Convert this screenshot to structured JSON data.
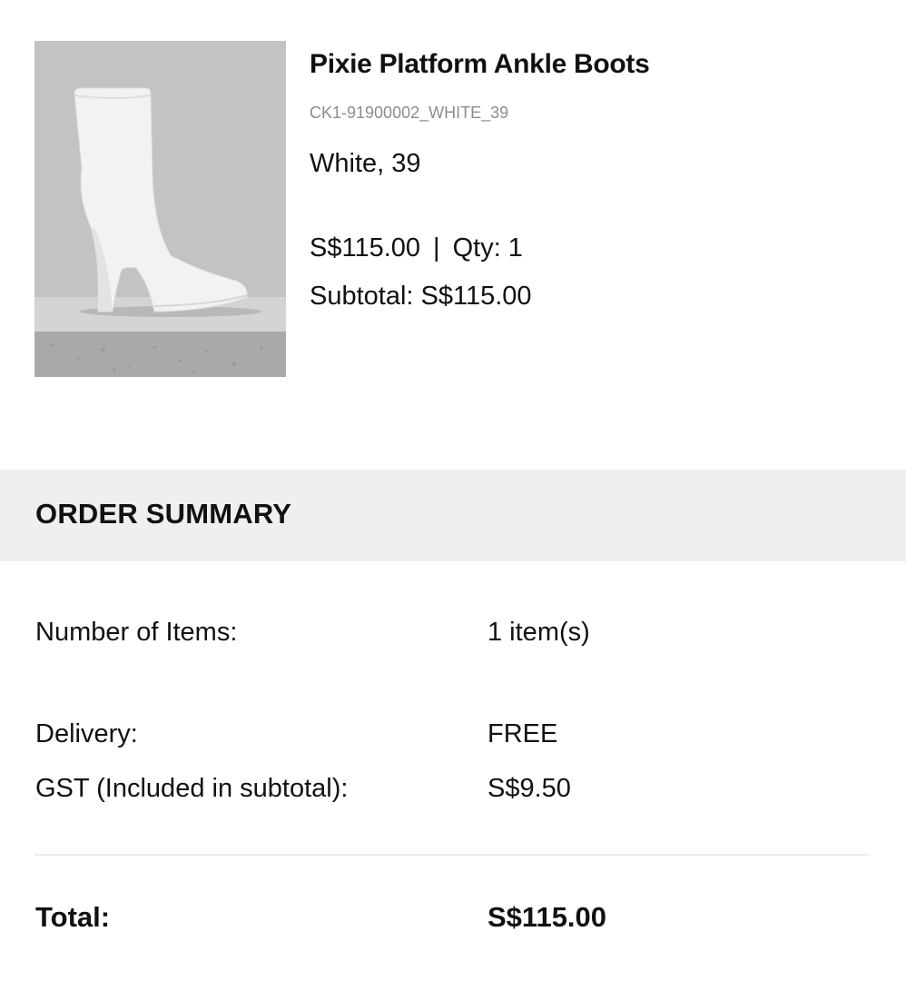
{
  "product": {
    "name": "Pixie Platform Ankle Boots",
    "sku": "CK1-91900002_WHITE_39",
    "variant": "White, 39",
    "price": "S$115.00",
    "separator": "|",
    "qty_label": "Qty: 1",
    "subtotal": "Subtotal: S$115.00",
    "image_icon": "boot-product-image",
    "image_color": "#f2f2f2"
  },
  "summary": {
    "title": "ORDER SUMMARY",
    "rows": [
      {
        "label": "Number of Items:",
        "value": "1 item(s)"
      },
      {
        "label": "Delivery:",
        "value": "FREE"
      },
      {
        "label": "GST (Included in subtotal):",
        "value": "S$9.50"
      }
    ],
    "total_label": "Total:",
    "total_value": "S$115.00",
    "header_bg": "#efefef"
  }
}
